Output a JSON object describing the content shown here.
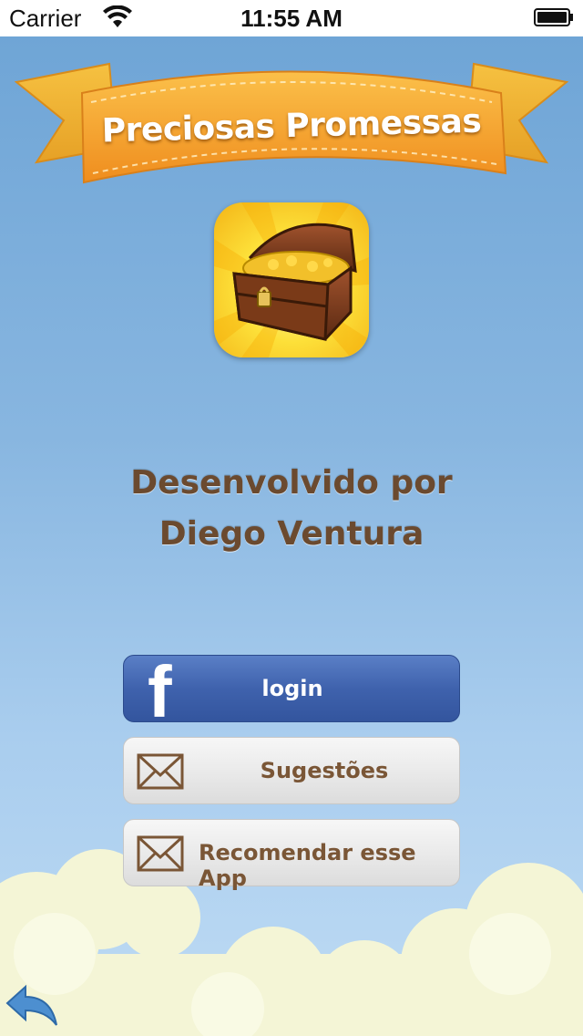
{
  "status_bar": {
    "carrier": "Carrier",
    "time": "11:55 AM",
    "icons": [
      "wifi-icon",
      "battery-icon"
    ]
  },
  "header": {
    "title": "Preciosas Promessas"
  },
  "app_icon": {
    "icon": "treasure-chest-icon"
  },
  "credits": {
    "line1": "Desenvolvido por",
    "line2": "Diego Ventura"
  },
  "buttons": {
    "facebook_login": {
      "label": "login",
      "icon": "facebook-icon"
    },
    "suggestions": {
      "label": "Sugestões",
      "icon": "envelope-icon"
    },
    "recommend": {
      "label": "Recomendar esse App",
      "icon": "envelope-icon"
    }
  },
  "navigation": {
    "back_icon": "back-arrow-icon"
  },
  "colors": {
    "sky_top": "#6fa5d6",
    "ribbon": "#f4a32a",
    "facebook": "#3f62ad",
    "text_brown": "#6b4a2f"
  }
}
